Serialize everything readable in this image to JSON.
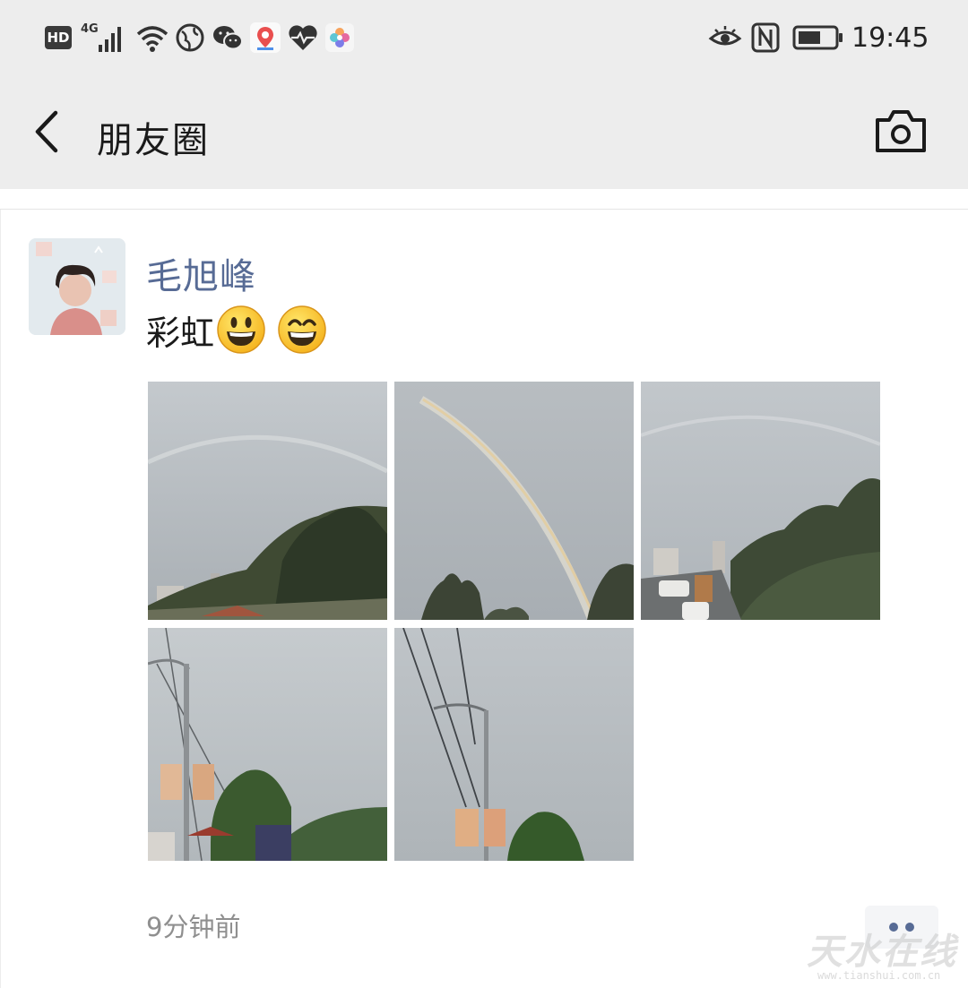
{
  "status_bar": {
    "hd_label": "HD",
    "network_label": "4G",
    "time": "19:45",
    "icons": [
      "hd-icon",
      "signal-icon",
      "wifi-icon",
      "globe-icon",
      "wechat-icon",
      "baidu-map-icon",
      "health-icon",
      "gallery-icon",
      "eye-comfort-icon",
      "nfc-icon",
      "battery-icon"
    ]
  },
  "nav": {
    "title": "朋友圈",
    "back_icon": "chevron-left-icon",
    "camera_icon": "camera-icon"
  },
  "post": {
    "author": "毛旭峰",
    "text": "彩虹",
    "emojis": [
      "smiley-emoji",
      "grin-emoji"
    ],
    "photo_count": 5,
    "timestamp": "9分钟前",
    "more_icon": "more-dots-icon"
  },
  "watermark": {
    "text": "天水在线",
    "url": "www.tianshui.com.cn"
  },
  "colors": {
    "bar_bg": "#ededed",
    "author_link": "#576b95",
    "timestamp": "#8f8f8f"
  }
}
